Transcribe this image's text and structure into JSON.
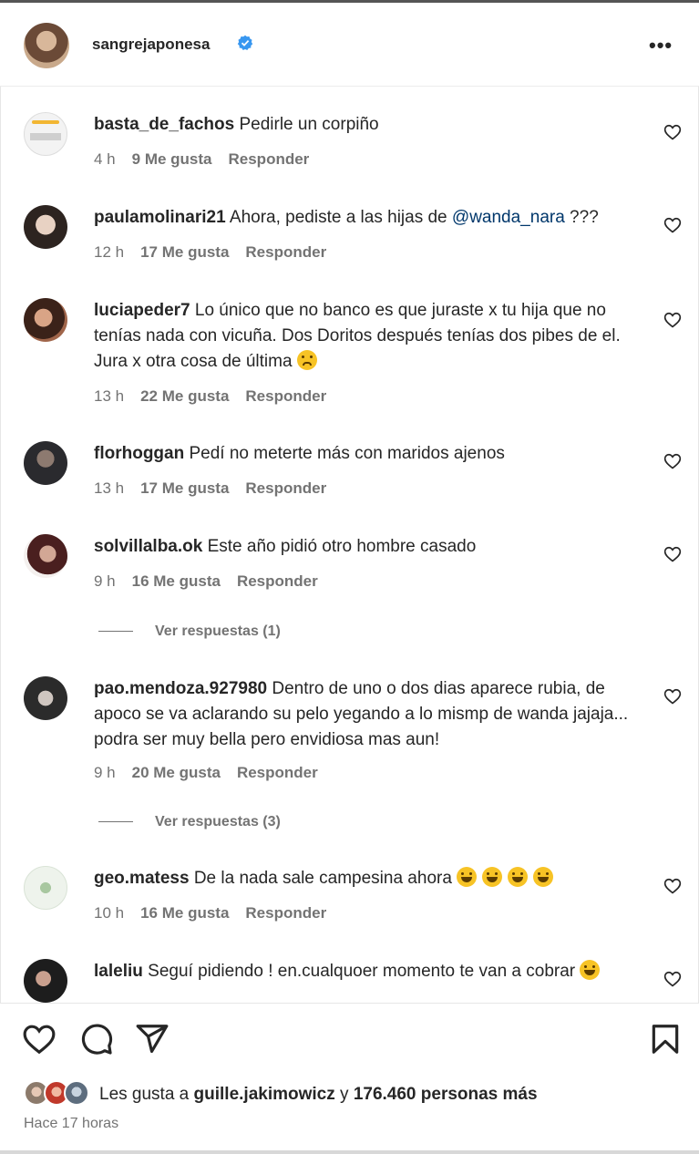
{
  "post": {
    "author": "sangrejaponesa",
    "verified": true
  },
  "comments": [
    {
      "user": "basta_de_fachos",
      "text": "Pedirle un corpiño",
      "time": "4 h",
      "likes": "9 Me gusta",
      "reply": "Responder"
    },
    {
      "user": "paulamolinari21",
      "text_before": "Ahora, pediste a las hijas de ",
      "mention": "@wanda_nara",
      "text_after": " ???",
      "time": "12 h",
      "likes": "17 Me gusta",
      "reply": "Responder"
    },
    {
      "user": "luciapeder7",
      "text": "Lo único que no banco es que juraste x tu hija que no tenías nada con vicuña. Dos Doritos después tenías dos pibes de el. Jura x otra cosa de última",
      "emoji": "sad-face",
      "time": "13 h",
      "likes": "22 Me gusta",
      "reply": "Responder"
    },
    {
      "user": "florhoggan",
      "text": "Pedí no meterte más con maridos ajenos",
      "time": "13 h",
      "likes": "17 Me gusta",
      "reply": "Responder"
    },
    {
      "user": "solvillalba.ok",
      "text": "Este año pidió otro hombre casado",
      "time": "9 h",
      "likes": "16 Me gusta",
      "reply": "Responder",
      "view_replies": "Ver respuestas (1)"
    },
    {
      "user": "pao.mendoza.927980",
      "text": "Dentro de uno o dos dias aparece rubia, de apoco se va aclarando su pelo yegando a lo mismp de wanda jajaja... podra ser muy bella pero envidiosa mas aun!",
      "time": "9 h",
      "likes": "20 Me gusta",
      "reply": "Responder",
      "view_replies": "Ver respuestas (3)"
    },
    {
      "user": "geo.matess",
      "text": "De la nada sale campesina ahora",
      "emoji": "laughing-face x4",
      "time": "10 h",
      "likes": "16 Me gusta",
      "reply": "Responder"
    },
    {
      "user": "laleliu",
      "text": "Seguí pidiendo ! en.cualquoer momento te van a cobrar",
      "emoji": "laughing-face"
    }
  ],
  "footer": {
    "liked_prefix": "Les gusta a ",
    "liked_user": "guille.jakimowicz",
    "liked_mid": " y ",
    "liked_count": "176.460 personas más",
    "time_ago": "Hace 17 horas"
  },
  "icons": {
    "more": "more-options-icon",
    "like": "heart-icon",
    "comment": "comment-icon",
    "share": "share-icon",
    "save": "bookmark-icon"
  },
  "colors": {
    "verified": "#3897f0",
    "mention": "#00376b",
    "meta": "#737373"
  }
}
